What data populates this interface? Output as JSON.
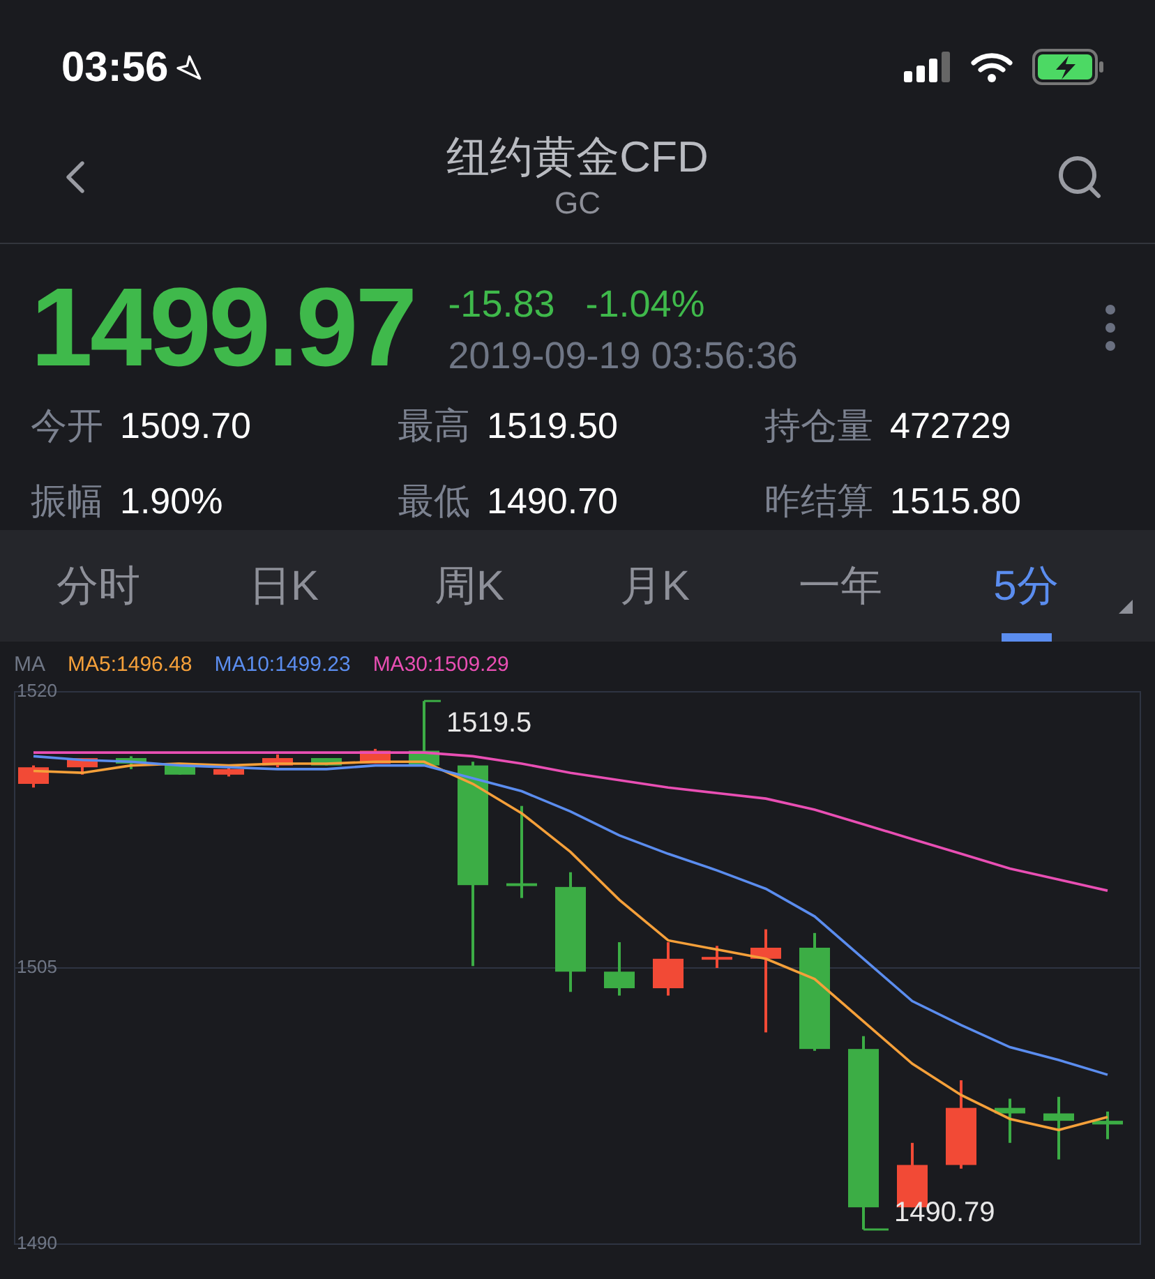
{
  "status_bar": {
    "time": "03:56"
  },
  "nav": {
    "title": "纽约黄金CFD",
    "subtitle": "GC"
  },
  "quote": {
    "price": "1499.97",
    "change": "-15.83",
    "change_pct": "-1.04%",
    "timestamp": "2019-09-19 03:56:36"
  },
  "stats": [
    {
      "label": "今开",
      "value": "1509.70"
    },
    {
      "label": "最高",
      "value": "1519.50"
    },
    {
      "label": "持仓量",
      "value": "472729"
    },
    {
      "label": "振幅",
      "value": "1.90%"
    },
    {
      "label": "最低",
      "value": "1490.70"
    },
    {
      "label": "昨结算",
      "value": "1515.80"
    }
  ],
  "tabs": [
    {
      "label": "分时",
      "selected": false
    },
    {
      "label": "日K",
      "selected": false
    },
    {
      "label": "周K",
      "selected": false
    },
    {
      "label": "月K",
      "selected": false
    },
    {
      "label": "一年",
      "selected": false
    },
    {
      "label": "5分",
      "selected": true
    }
  ],
  "chart": {
    "legend_label": "MA",
    "chart_data": {
      "type": "line",
      "ylim": [
        1490,
        1520
      ],
      "yticks": [
        1490,
        1505,
        1520
      ],
      "series": [
        {
          "type": "candlestick",
          "ohlc": [
            [
              1515.0,
              1516.0,
              1514.8,
              1515.9
            ],
            [
              1515.9,
              1516.4,
              1515.5,
              1516.4
            ],
            [
              1516.4,
              1516.5,
              1515.8,
              1516.1
            ],
            [
              1516.1,
              1516.1,
              1515.5,
              1515.5
            ],
            [
              1515.5,
              1515.9,
              1515.4,
              1515.8
            ],
            [
              1516.0,
              1516.6,
              1515.9,
              1516.4
            ],
            [
              1516.4,
              1516.4,
              1516.0,
              1516.0
            ],
            [
              1516.1,
              1516.9,
              1516.1,
              1516.8
            ],
            [
              1516.8,
              1519.5,
              1516.0,
              1516.0
            ],
            [
              1516.0,
              1516.2,
              1505.1,
              1509.5
            ],
            [
              1509.6,
              1513.8,
              1508.8,
              1509.5
            ],
            [
              1509.4,
              1510.2,
              1503.7,
              1504.8
            ],
            [
              1504.8,
              1506.4,
              1503.5,
              1503.9
            ],
            [
              1503.9,
              1506.4,
              1503.5,
              1505.5
            ],
            [
              1505.5,
              1506.2,
              1505.0,
              1505.6
            ],
            [
              1505.5,
              1507.1,
              1501.5,
              1506.1
            ],
            [
              1506.1,
              1506.9,
              1500.5,
              1500.6
            ],
            [
              1500.6,
              1501.3,
              1490.8,
              1492.0
            ],
            [
              1492.0,
              1495.5,
              1492.0,
              1494.3
            ],
            [
              1494.3,
              1498.9,
              1494.1,
              1497.4
            ],
            [
              1497.4,
              1497.9,
              1495.5,
              1497.1
            ],
            [
              1497.1,
              1498.0,
              1494.6,
              1496.7
            ],
            [
              1496.7,
              1497.2,
              1495.7,
              1496.5
            ]
          ]
        },
        {
          "name": "MA5:1496.48",
          "color": "#f5a03a",
          "values": [
            1515.7,
            1515.6,
            1516.0,
            1516.1,
            1516.0,
            1516.1,
            1516.1,
            1516.2,
            1516.2,
            1515.0,
            1513.4,
            1511.3,
            1508.7,
            1506.5,
            1506.0,
            1505.5,
            1504.4,
            1502.1,
            1499.8,
            1498.1,
            1496.8,
            1496.2,
            1496.9
          ]
        },
        {
          "name": "MA10:1499.23",
          "color": "#5b8def",
          "values": [
            1516.5,
            1516.3,
            1516.2,
            1516.0,
            1515.9,
            1515.8,
            1515.8,
            1516.0,
            1516.0,
            1515.3,
            1514.6,
            1513.5,
            1512.2,
            1511.2,
            1510.3,
            1509.3,
            1507.8,
            1505.5,
            1503.2,
            1501.9,
            1500.7,
            1500.0,
            1499.2
          ]
        },
        {
          "name": "MA30:1509.29",
          "color": "#e94fb4",
          "values": [
            1516.7,
            1516.7,
            1516.7,
            1516.7,
            1516.7,
            1516.7,
            1516.7,
            1516.7,
            1516.7,
            1516.5,
            1516.1,
            1515.6,
            1515.2,
            1514.8,
            1514.5,
            1514.2,
            1513.6,
            1512.8,
            1512.0,
            1511.2,
            1510.4,
            1509.8,
            1509.2
          ]
        }
      ],
      "annotations": [
        "1519.5",
        "1490.79"
      ]
    }
  }
}
